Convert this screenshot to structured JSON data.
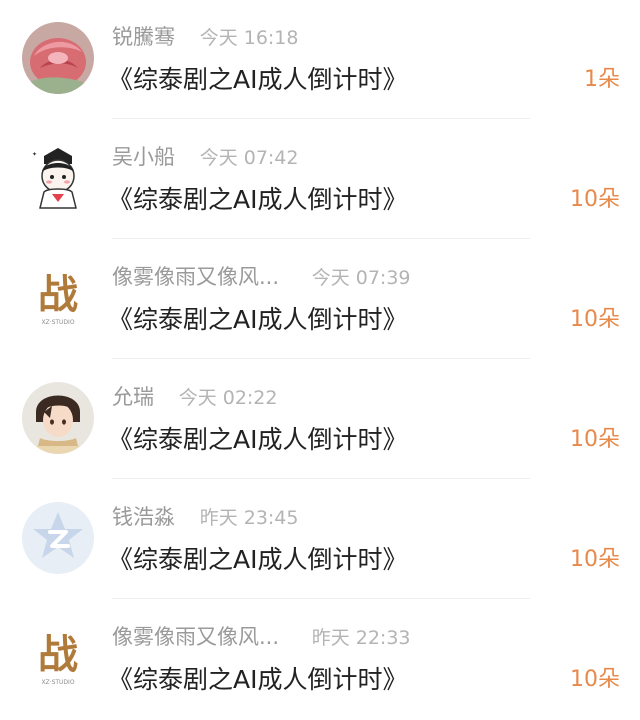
{
  "rows": [
    {
      "name": "锐騰骞",
      "time": "今天 16:18",
      "title": "《综泰剧之AI成人倒计时》",
      "gift": "1朵",
      "avatar": "rose-avatar"
    },
    {
      "name": "吴小船",
      "time": "今天 07:42",
      "title": "《综泰剧之AI成人倒计时》",
      "gift": "10朵",
      "avatar": "cartoon-avatar"
    },
    {
      "name": "像雾像雨又像风...",
      "time": "今天 07:39",
      "title": "《综泰剧之AI成人倒计时》",
      "gift": "10朵",
      "avatar": "calligraphy-avatar"
    },
    {
      "name": "允瑞",
      "time": "今天 02:22",
      "title": "《综泰剧之AI成人倒计时》",
      "gift": "10朵",
      "avatar": "anime-boy-avatar"
    },
    {
      "name": "钱浩淼",
      "time": "昨天 23:45",
      "title": "《综泰剧之AI成人倒计时》",
      "gift": "10朵",
      "avatar": "default-avatar"
    },
    {
      "name": "像雾像雨又像风...",
      "time": "昨天 22:33",
      "title": "《综泰剧之AI成人倒计时》",
      "gift": "10朵",
      "avatar": "calligraphy-avatar"
    }
  ],
  "calligraphy_char": "战",
  "calligraphy_subtext": "XZ·STUDIO",
  "colors": {
    "gift": "#e8894a",
    "name": "#9a9a9a",
    "time": "#b4b4b4",
    "title": "#222222"
  }
}
